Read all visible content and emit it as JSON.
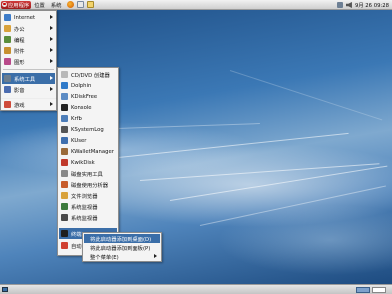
{
  "top_panel": {
    "apps_label": "应用程序",
    "places_label": "位置",
    "system_label": "系统",
    "clock": "9月 26 09:28",
    "launchers": [
      "web-browser-icon",
      "mail-icon",
      "notes-icon"
    ],
    "tray": [
      "network-icon",
      "volume-icon"
    ]
  },
  "apps_menu": {
    "items": [
      {
        "label": "Internet",
        "icon": "globe-icon",
        "color": "#3d7cc9"
      },
      {
        "label": "办公",
        "icon": "office-icon",
        "color": "#d9a23b"
      },
      {
        "label": "编程",
        "icon": "code-icon",
        "color": "#5a8e3b"
      },
      {
        "label": "附件",
        "icon": "accessories-icon",
        "color": "#c7902f"
      },
      {
        "label": "图形",
        "icon": "graphics-icon",
        "color": "#b94a8a"
      },
      {
        "label": "系统工具",
        "icon": "system-tools-icon",
        "color": "#6b7d8f"
      },
      {
        "label": "影音",
        "icon": "media-icon",
        "color": "#4b6cb0"
      },
      {
        "label": "游戏",
        "icon": "games-icon",
        "color": "#cf4b3a"
      }
    ]
  },
  "system_tools_menu": {
    "items": [
      {
        "label": "CD/DVD 创建器",
        "icon": "disc-icon",
        "color": "#b9b9b9"
      },
      {
        "label": "Dolphin",
        "icon": "dolphin-icon",
        "color": "#2f7ac9"
      },
      {
        "label": "KDiskFree",
        "icon": "disk-free-icon",
        "color": "#5b8bc4"
      },
      {
        "label": "Konsole",
        "icon": "terminal-icon",
        "color": "#222222"
      },
      {
        "label": "Krfb",
        "icon": "desktop-sharing-icon",
        "color": "#4d7db8"
      },
      {
        "label": "KSystemLog",
        "icon": "log-icon",
        "color": "#555555"
      },
      {
        "label": "KUser",
        "icon": "user-icon",
        "color": "#3f6fae"
      },
      {
        "label": "KWalletManager",
        "icon": "wallet-icon",
        "color": "#9a6a3a"
      },
      {
        "label": "KwikDisk",
        "icon": "kwikdisk-icon",
        "color": "#c0392b"
      },
      {
        "label": "磁盘实用工具",
        "icon": "disk-utility-icon",
        "color": "#888888"
      },
      {
        "label": "磁盘使用分析器",
        "icon": "disk-usage-icon",
        "color": "#c75b2a"
      },
      {
        "label": "文件浏览器",
        "icon": "file-browser-icon",
        "color": "#d9a23b"
      },
      {
        "label": "系统监视器",
        "icon": "system-monitor-icon",
        "color": "#3c7a3c"
      },
      {
        "label": "系统监视器",
        "icon": "system-monitor-icon",
        "color": "#4a4a4a"
      },
      {
        "label": "终端",
        "icon": "terminal-icon",
        "color": "#1e1e1e"
      },
      {
        "label": "自动检测",
        "icon": "autodetect-icon",
        "color": "#d04030"
      }
    ]
  },
  "context_menu": {
    "items": [
      {
        "label": "将此启动器添加到桌面(D)"
      },
      {
        "label": "将此启动器添加到面板(P)"
      },
      {
        "label": "整个菜单(E)"
      }
    ]
  }
}
